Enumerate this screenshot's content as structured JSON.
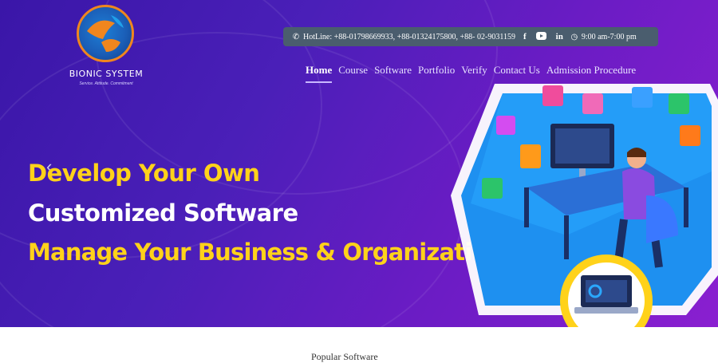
{
  "brand": {
    "name": "BIONIC SYSTEM",
    "tagline": "Service. Attitude. Commitment"
  },
  "topbar": {
    "hotline": "HotLine: +88-01798669933, +88-01324175800, +88- 02-9031159",
    "hours": "9:00 am-7:00 pm",
    "icons": [
      "phone-icon",
      "facebook-icon",
      "youtube-icon",
      "linkedin-icon",
      "clock-icon"
    ]
  },
  "nav": {
    "items": [
      "Home",
      "Course",
      "Software",
      "Portfolio",
      "Verify",
      "Contact Us",
      "Admission Procedure"
    ],
    "active": "Home"
  },
  "hero": {
    "line1": "Develop Your  Own",
    "line2": "Customized Software",
    "line3": "Manage Your Business & Organization",
    "colors": {
      "accent": "#ffd21a",
      "background": "#4a1fb8"
    }
  },
  "next_section": {
    "title_fragment": "Popular Software"
  }
}
